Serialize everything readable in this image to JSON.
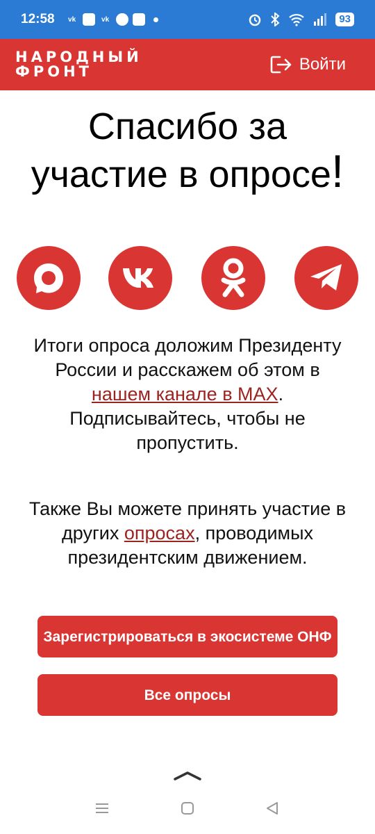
{
  "status": {
    "time": "12:58",
    "notification_icons": [
      "vk-icon",
      "app-icon",
      "vk-icon",
      "chat-icon",
      "app-icon"
    ],
    "battery": "93"
  },
  "header": {
    "logo_line1": "НАРОДНЫЙ",
    "logo_line2": "ФРОНТ",
    "login_label": "Войти",
    "bg_color": "#d93533"
  },
  "title": {
    "line1": "Спасибо за",
    "line2": "участие в опросе",
    "exclamation": "!"
  },
  "socials": [
    {
      "name": "max-icon"
    },
    {
      "name": "vk-icon"
    },
    {
      "name": "odnoklassniki-icon"
    },
    {
      "name": "telegram-icon"
    }
  ],
  "paragraph1": {
    "text_before": "Итоги опроса доложим Президенту России и расскажем об этом в ",
    "link": "нашем канале в MAX",
    "text_after": ". Подписывайтесь, чтобы не пропустить."
  },
  "paragraph2": {
    "text_before": "Также Вы можете принять участие в других ",
    "link": "опросах",
    "text_after": ", проводимых президентским движением."
  },
  "buttons": {
    "register": "Зарегистрироваться в экосистеме ОНФ",
    "all_polls": "Все опросы"
  },
  "colors": {
    "accent": "#d93533",
    "link": "#9b2421",
    "statusbar": "#2b7bd4"
  }
}
